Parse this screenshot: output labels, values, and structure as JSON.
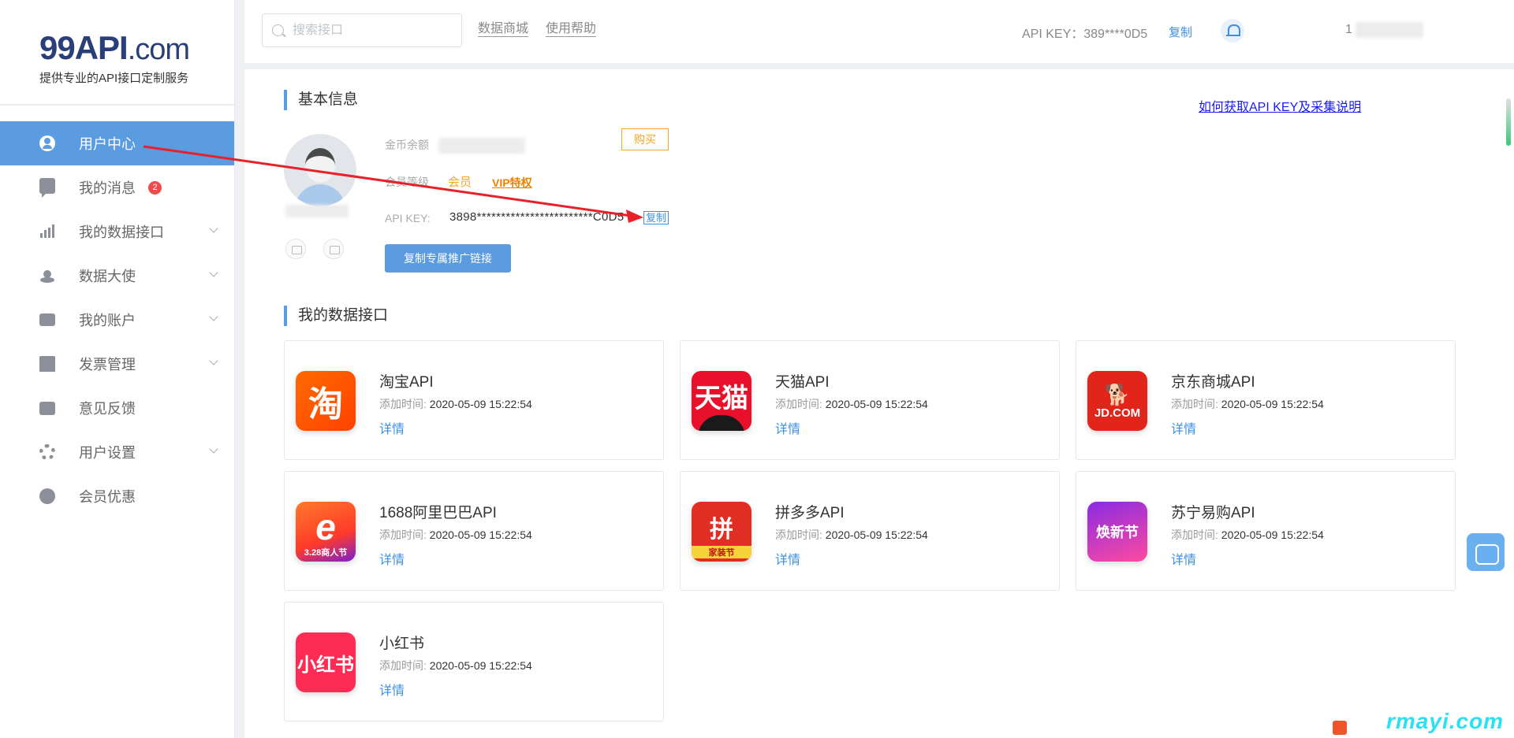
{
  "logo": {
    "title_main": "99API",
    "title_domain": ".com",
    "subtitle": "提供专业的API接口定制服务"
  },
  "sidebar": {
    "items": [
      {
        "label": "用户中心",
        "icon": "user-icon",
        "active": true
      },
      {
        "label": "我的消息",
        "icon": "message-icon",
        "badge": "2"
      },
      {
        "label": "我的数据接口",
        "icon": "chart-icon",
        "expandable": true
      },
      {
        "label": "数据大使",
        "icon": "people-icon",
        "expandable": true
      },
      {
        "label": "我的账户",
        "icon": "wallet-icon",
        "expandable": true
      },
      {
        "label": "发票管理",
        "icon": "invoice-icon",
        "expandable": true
      },
      {
        "label": "意见反馈",
        "icon": "feedback-icon"
      },
      {
        "label": "用户设置",
        "icon": "gear-icon",
        "expandable": true
      },
      {
        "label": "会员优惠",
        "icon": "heart-icon"
      }
    ]
  },
  "topbar": {
    "search_placeholder": "搜索接口",
    "links": [
      "数据商城",
      "使用帮助"
    ],
    "apikey_label": "API KEY：389****0D5",
    "copy_label": "复制",
    "username_prefix": "1"
  },
  "basic_info": {
    "title": "基本信息",
    "help_link": "如何获取API KEY及采集说明",
    "coin_label": "金币余额",
    "buy_label": "购买",
    "member_label": "会员等级",
    "member_value": "会员",
    "vip_label": "VIP特权",
    "apikey_label": "API KEY:",
    "apikey_value": "3898************************C0D5",
    "copy_label": "复制",
    "promo_button": "复制专属推广链接"
  },
  "apis": {
    "title": "我的数据接口",
    "time_label": "添加时间:",
    "detail_label": "详情",
    "items": [
      {
        "name": "淘宝API",
        "time": "2020-05-09 15:22:54",
        "logo_text": "淘"
      },
      {
        "name": "天猫API",
        "time": "2020-05-09 15:22:54",
        "logo_text": "天猫"
      },
      {
        "name": "京东商城API",
        "time": "2020-05-09 15:22:54",
        "logo_text": "JD.COM"
      },
      {
        "name": "1688阿里巴巴API",
        "time": "2020-05-09 15:22:54",
        "logo_text": "e",
        "logo_sub": "3.28商人节"
      },
      {
        "name": "拼多多API",
        "time": "2020-05-09 15:22:54",
        "logo_text": "拼",
        "logo_sub": "家装节"
      },
      {
        "name": "苏宁易购API",
        "time": "2020-05-09 15:22:54",
        "logo_text": "焕新节"
      },
      {
        "name": "小红书",
        "time": "2020-05-09 15:22:54",
        "logo_text": "小红书"
      }
    ]
  },
  "watermark": "rmayi.com",
  "colors": {
    "accent": "#5b9be0",
    "link": "#3d8fe0",
    "orange": "#f5a623",
    "annotation_arrow": "#e8202a"
  }
}
